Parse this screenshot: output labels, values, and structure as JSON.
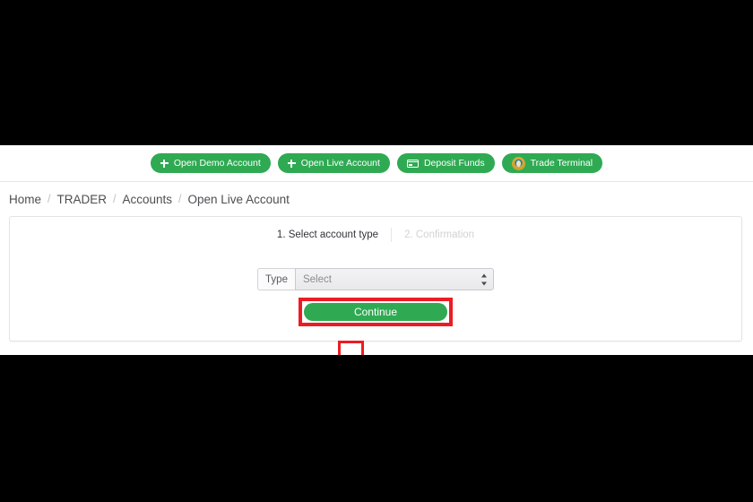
{
  "quick_actions": [
    {
      "label": "Open Demo Account",
      "icon": "plus-icon"
    },
    {
      "label": "Open Live Account",
      "icon": "plus-icon"
    },
    {
      "label": "Deposit Funds",
      "icon": "credit-card-icon"
    },
    {
      "label": "Trade Terminal",
      "icon": "terminal-badge-icon"
    }
  ],
  "breadcrumb": {
    "separator": "/",
    "items": [
      {
        "label": "Home"
      },
      {
        "label": "TRADER"
      },
      {
        "label": "Accounts"
      },
      {
        "label": "Open Live Account"
      }
    ]
  },
  "wizard": {
    "steps": [
      {
        "label": "1. Select account type",
        "state": "active"
      },
      {
        "label": "2. Confirmation",
        "state": "inactive"
      }
    ]
  },
  "form": {
    "type_label": "Type",
    "type_value": "Select",
    "type_options": [
      "Select"
    ],
    "continue_label": "Continue"
  },
  "colors": {
    "brand_green": "#2faa53",
    "highlight_red": "#ec1c24",
    "text_dark": "#4e4e52",
    "text_muted": "#d2d2d6",
    "panel_border": "#e3e3e8"
  }
}
